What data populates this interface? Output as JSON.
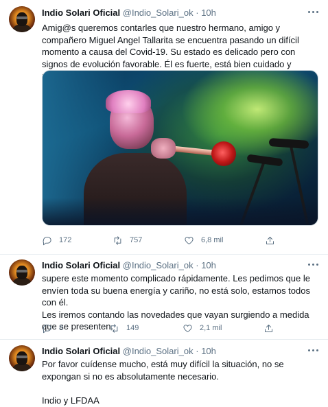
{
  "tweets": [
    {
      "name": "Indio Solari Oficial",
      "handle": "@Indio_Solari_ok",
      "dot": "·",
      "time": "10h",
      "lines": [
        "Amig@s queremos contarles que nuestro hermano, amigo y compañero Miguel Angel Tallarita se encuentra pasando un difícil momento a causa del Covid-19. Su estado es delicado pero con signos de evolución favorable. Él es fuerte, está bien cuidado y rodeado de amor, confiamos en que"
      ],
      "stats": {
        "replies": "172",
        "retweets": "757",
        "likes": "6,8 mil"
      }
    },
    {
      "name": "Indio Solari Oficial",
      "handle": "@Indio_Solari_ok",
      "dot": "·",
      "time": "10h",
      "lines": [
        "supere este momento complicado rápidamente. Les pedimos que le envíen toda su buena energía y cariño, no está solo, estamos todos con él.",
        "Les iremos contando las novedades que vayan surgiendo a medida que se presenten."
      ],
      "stats": {
        "replies": "8",
        "retweets": "149",
        "likes": "2,1 mil"
      }
    },
    {
      "name": "Indio Solari Oficial",
      "handle": "@Indio_Solari_ok",
      "dot": "·",
      "time": "10h",
      "lines": [
        "Por favor cuídense mucho, está muy difícil la situación, no se expongan si no es absolutamente necesario.",
        "",
        "Indio y LFDAA"
      ]
    }
  ],
  "icons": {
    "reply": "reply-icon",
    "retweet": "retweet-icon",
    "like": "heart-icon",
    "share": "share-icon",
    "more": "more-icon"
  },
  "colors": {
    "text": "#0f1419",
    "secondary": "#5b7083",
    "divider": "#e6ecf0"
  }
}
